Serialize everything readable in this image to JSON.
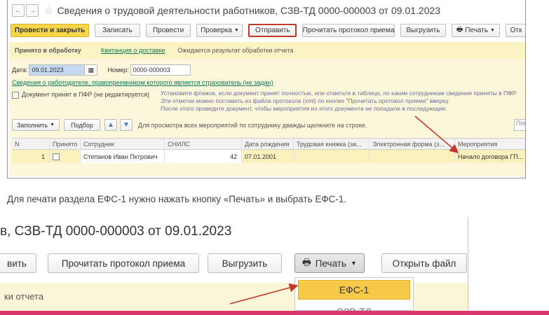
{
  "shot1": {
    "title": "Сведения о трудовой деятельности работников, СЗВ-ТД 0000-000003 от 09.01.2023",
    "nav_back": "←",
    "nav_forward": "→",
    "star": "☆",
    "toolbar": {
      "post_close": "Провести и закрыть",
      "save": "Записать",
      "post": "Провести",
      "check": "Проверка",
      "send": "Отправить",
      "read_protocol": "Прочитать протокол приема",
      "upload": "Выгрузить",
      "print": "Печать",
      "more": "Отк"
    },
    "status": {
      "state": "Принято в обработку",
      "receipt_link": "Квитанция о доставке",
      "note": "Ожидается результат обработки отчета"
    },
    "date_label": "Дата:",
    "date_value": "09.01.2023",
    "number_label": "Номер:",
    "number_value": "0000-000003",
    "successor_link": "Сведения о работодателе, правопреемником которого является страхователь (не задан)",
    "pfr_label": "Документ принят в ПФР (не редактируется)",
    "hint_lines": [
      "Установите флажок, если документ принят полностью, или отметьте в таблице, по каким сотрудникам сведения приняты в ПФР.",
      "Эти отметки можно поставить из файла протокола (xml) по кнопке \"Прочитать протокол приема\" вверху.",
      "После этого проведите документ, чтобы мероприятия из этого документа не попадали в последующие."
    ],
    "table_toolbar": {
      "fill": "Заполнить",
      "select": "Подбор",
      "hint": "Для просмотра всех мероприятий по сотруднику дважды щелкните на строке.",
      "search_placeholder": "Пои"
    },
    "table": {
      "columns": [
        "N",
        "Принято",
        "Сотрудник",
        "СНИЛС",
        "Дата рождения",
        "Трудовая книжка (за...",
        "Электронная форма (з...",
        "Мероприятия"
      ],
      "rows": [
        {
          "n": "1",
          "employee": "Степанов Иван Пктрович",
          "snils": "42",
          "birth": "07.01.2001",
          "book": "",
          "eform": "",
          "events": "Начало договора ГП..."
        }
      ]
    }
  },
  "caption": "Для печати раздела ЕФС-1 нужно нажать кнопку «Печать» и выбрать ЕФС-1.",
  "shot2": {
    "title": "в, СЗВ-ТД 0000-000003 от 09.01.2023",
    "buttons": {
      "post_partial": "вить",
      "read_protocol": "Прочитать протокол приема",
      "upload": "Выгрузить",
      "print": "Печать",
      "open_file": "Открыть файл"
    },
    "status_partial": "ки отчета",
    "menu": {
      "efs1": "ЕФС-1",
      "szvtd": "СЗВ-ТД"
    }
  },
  "colors": {
    "primary_button": "#f9d649",
    "status_bg": "#fbf3c4",
    "link": "#0a7a55",
    "highlight_border": "#c0392b",
    "arrow": "#c0392b",
    "bottom_bar": "#d9376e"
  }
}
